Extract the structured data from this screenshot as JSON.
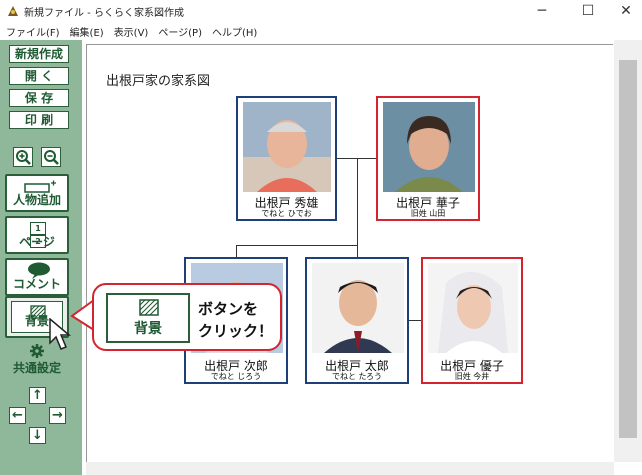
{
  "window": {
    "title": "新規ファイル - らくらく家系図作成",
    "minimize": "─",
    "maximize": "☐",
    "close": "✕"
  },
  "menu": [
    "ファイル(F)",
    "編集(E)",
    "表示(V)",
    "ページ(P)",
    "ヘルプ(H)"
  ],
  "sidebar": {
    "file_buttons": [
      "新規作成",
      "開 く",
      "保 存",
      "印 刷"
    ],
    "add_person": "人物追加",
    "page": "ページ",
    "page_icon": [
      "1",
      "2"
    ],
    "comment": "コメント",
    "background": "背景",
    "common_settings": "共通設定",
    "arrows": {
      "up": "↑",
      "left": "←",
      "right": "→",
      "down": "↓"
    }
  },
  "canvas": {
    "title": "出根戸家の家系図",
    "people": [
      {
        "name": "出根戸  秀雄",
        "sub": "でねと  ひでお"
      },
      {
        "name": "出根戸  華子",
        "sub": "旧姓 山田"
      },
      {
        "name": "出根戸  次郎",
        "sub": "でねと  じろう"
      },
      {
        "name": "出根戸  太郎",
        "sub": "でねと  たろう"
      },
      {
        "name": "出根戸  優子",
        "sub": "旧姓 今井"
      }
    ]
  },
  "callout": {
    "button_label": "背景",
    "line1": "ボタンを",
    "line2": "クリック！"
  },
  "colors": {
    "sidebar": "#8fb89a",
    "button_border": "#2b5f3a",
    "male_frame": "#1e3f77",
    "female_frame": "#d3242f"
  }
}
